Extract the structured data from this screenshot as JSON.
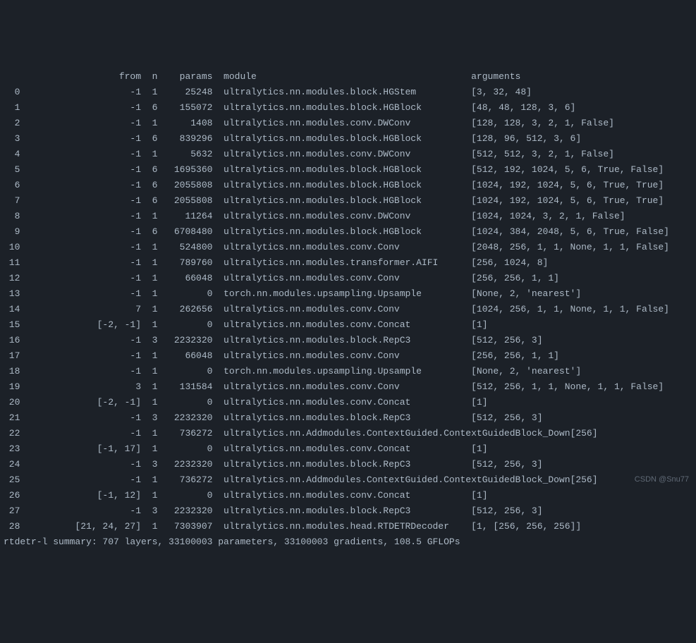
{
  "header": {
    "idx": "",
    "from": "from",
    "n": "n",
    "params": "params",
    "module": "module",
    "arguments": "arguments"
  },
  "rows": [
    {
      "idx": "0",
      "from": "-1",
      "n": "1",
      "params": "25248",
      "module": "ultralytics.nn.modules.block.HGStem",
      "arguments": "[3, 32, 48]"
    },
    {
      "idx": "1",
      "from": "-1",
      "n": "6",
      "params": "155072",
      "module": "ultralytics.nn.modules.block.HGBlock",
      "arguments": "[48, 48, 128, 3, 6]"
    },
    {
      "idx": "2",
      "from": "-1",
      "n": "1",
      "params": "1408",
      "module": "ultralytics.nn.modules.conv.DWConv",
      "arguments": "[128, 128, 3, 2, 1, False]"
    },
    {
      "idx": "3",
      "from": "-1",
      "n": "6",
      "params": "839296",
      "module": "ultralytics.nn.modules.block.HGBlock",
      "arguments": "[128, 96, 512, 3, 6]"
    },
    {
      "idx": "4",
      "from": "-1",
      "n": "1",
      "params": "5632",
      "module": "ultralytics.nn.modules.conv.DWConv",
      "arguments": "[512, 512, 3, 2, 1, False]"
    },
    {
      "idx": "5",
      "from": "-1",
      "n": "6",
      "params": "1695360",
      "module": "ultralytics.nn.modules.block.HGBlock",
      "arguments": "[512, 192, 1024, 5, 6, True, False]"
    },
    {
      "idx": "6",
      "from": "-1",
      "n": "6",
      "params": "2055808",
      "module": "ultralytics.nn.modules.block.HGBlock",
      "arguments": "[1024, 192, 1024, 5, 6, True, True]"
    },
    {
      "idx": "7",
      "from": "-1",
      "n": "6",
      "params": "2055808",
      "module": "ultralytics.nn.modules.block.HGBlock",
      "arguments": "[1024, 192, 1024, 5, 6, True, True]"
    },
    {
      "idx": "8",
      "from": "-1",
      "n": "1",
      "params": "11264",
      "module": "ultralytics.nn.modules.conv.DWConv",
      "arguments": "[1024, 1024, 3, 2, 1, False]"
    },
    {
      "idx": "9",
      "from": "-1",
      "n": "6",
      "params": "6708480",
      "module": "ultralytics.nn.modules.block.HGBlock",
      "arguments": "[1024, 384, 2048, 5, 6, True, False]"
    },
    {
      "idx": "10",
      "from": "-1",
      "n": "1",
      "params": "524800",
      "module": "ultralytics.nn.modules.conv.Conv",
      "arguments": "[2048, 256, 1, 1, None, 1, 1, False]"
    },
    {
      "idx": "11",
      "from": "-1",
      "n": "1",
      "params": "789760",
      "module": "ultralytics.nn.modules.transformer.AIFI",
      "arguments": "[256, 1024, 8]"
    },
    {
      "idx": "12",
      "from": "-1",
      "n": "1",
      "params": "66048",
      "module": "ultralytics.nn.modules.conv.Conv",
      "arguments": "[256, 256, 1, 1]"
    },
    {
      "idx": "13",
      "from": "-1",
      "n": "1",
      "params": "0",
      "module": "torch.nn.modules.upsampling.Upsample",
      "arguments": "[None, 2, 'nearest']"
    },
    {
      "idx": "14",
      "from": "7",
      "n": "1",
      "params": "262656",
      "module": "ultralytics.nn.modules.conv.Conv",
      "arguments": "[1024, 256, 1, 1, None, 1, 1, False]"
    },
    {
      "idx": "15",
      "from": "[-2, -1]",
      "n": "1",
      "params": "0",
      "module": "ultralytics.nn.modules.conv.Concat",
      "arguments": "[1]"
    },
    {
      "idx": "16",
      "from": "-1",
      "n": "3",
      "params": "2232320",
      "module": "ultralytics.nn.modules.block.RepC3",
      "arguments": "[512, 256, 3]"
    },
    {
      "idx": "17",
      "from": "-1",
      "n": "1",
      "params": "66048",
      "module": "ultralytics.nn.modules.conv.Conv",
      "arguments": "[256, 256, 1, 1]"
    },
    {
      "idx": "18",
      "from": "-1",
      "n": "1",
      "params": "0",
      "module": "torch.nn.modules.upsampling.Upsample",
      "arguments": "[None, 2, 'nearest']"
    },
    {
      "idx": "19",
      "from": "3",
      "n": "1",
      "params": "131584",
      "module": "ultralytics.nn.modules.conv.Conv",
      "arguments": "[512, 256, 1, 1, None, 1, 1, False]"
    },
    {
      "idx": "20",
      "from": "[-2, -1]",
      "n": "1",
      "params": "0",
      "module": "ultralytics.nn.modules.conv.Concat",
      "arguments": "[1]"
    },
    {
      "idx": "21",
      "from": "-1",
      "n": "3",
      "params": "2232320",
      "module": "ultralytics.nn.modules.block.RepC3",
      "arguments": "[512, 256, 3]"
    },
    {
      "idx": "22",
      "from": "-1",
      "n": "1",
      "params": "736272",
      "module": "ultralytics.nn.Addmodules.ContextGuided.ContextGuidedBlock_Down",
      "arguments": "[256]"
    },
    {
      "idx": "23",
      "from": "[-1, 17]",
      "n": "1",
      "params": "0",
      "module": "ultralytics.nn.modules.conv.Concat",
      "arguments": "[1]"
    },
    {
      "idx": "24",
      "from": "-1",
      "n": "3",
      "params": "2232320",
      "module": "ultralytics.nn.modules.block.RepC3",
      "arguments": "[512, 256, 3]"
    },
    {
      "idx": "25",
      "from": "-1",
      "n": "1",
      "params": "736272",
      "module": "ultralytics.nn.Addmodules.ContextGuided.ContextGuidedBlock_Down",
      "arguments": "[256]"
    },
    {
      "idx": "26",
      "from": "[-1, 12]",
      "n": "1",
      "params": "0",
      "module": "ultralytics.nn.modules.conv.Concat",
      "arguments": "[1]"
    },
    {
      "idx": "27",
      "from": "-1",
      "n": "3",
      "params": "2232320",
      "module": "ultralytics.nn.modules.block.RepC3",
      "arguments": "[512, 256, 3]"
    },
    {
      "idx": "28",
      "from": "[21, 24, 27]",
      "n": "1",
      "params": "7303907",
      "module": "ultralytics.nn.modules.head.RTDETRDecoder",
      "arguments": "[1, [256, 256, 256]]"
    }
  ],
  "summary": "rtdetr-l summary: 707 layers, 33100003 parameters, 33100003 gradients, 108.5 GFLOPs",
  "watermark": "CSDN @Snu77"
}
